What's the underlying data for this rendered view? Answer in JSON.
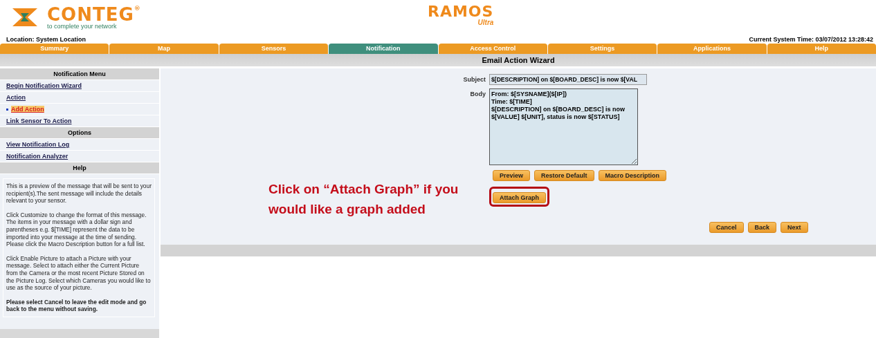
{
  "header": {
    "brand": "CONTEG",
    "brand_mark": "®",
    "tagline": "to complete your network",
    "product": "RAMOS",
    "product_sub": "Ultra"
  },
  "location": "Location: System Location",
  "system_time": "Current System Time: 03/07/2012 13:28:42",
  "tabs": [
    {
      "label": "Summary",
      "selected": false
    },
    {
      "label": "Map",
      "selected": false
    },
    {
      "label": "Sensors",
      "selected": false
    },
    {
      "label": "Notification",
      "selected": true
    },
    {
      "label": "Access Control",
      "selected": false
    },
    {
      "label": "Settings",
      "selected": false
    },
    {
      "label": "Applications",
      "selected": false
    },
    {
      "label": "Help",
      "selected": false
    }
  ],
  "page_title": "Email Action Wizard",
  "sidebar": {
    "sections": [
      {
        "title": "Notification Menu",
        "items": [
          {
            "label": "Begin Notification Wizard",
            "kind": "link",
            "selected": false
          },
          {
            "label": "Action",
            "kind": "link",
            "selected": false
          },
          {
            "label": "Add Action",
            "kind": "sub",
            "selected": true
          },
          {
            "label": "Link Sensor To Action",
            "kind": "link",
            "selected": false
          }
        ]
      },
      {
        "title": "Options",
        "items": [
          {
            "label": "View Notification Log",
            "kind": "link",
            "selected": false
          },
          {
            "label": "Notification Analyzer",
            "kind": "link",
            "selected": false
          }
        ]
      },
      {
        "title": "Help"
      }
    ],
    "help_paragraphs": [
      "This is a preview of the message that will be sent to your recipient(s).The sent message will include the details relevant to your sensor.",
      "Click Customize to change the format of this message. The items in your message with a dollar sign and parentheses e.g. $[TIME] represent the data to be imported into your message at the time of sending. Please click the Macro Description button for a full list.",
      "Click Enable Picture to attach a Picture with your message. Select to attach either the Current Picture from the Camera or the most recent Picture Stored on the Picture Log. Select which Cameras you would like to use as the source of your picture.",
      "**Please select Cancel to leave the edit mode and go back to the menu without saving.**"
    ]
  },
  "form": {
    "subject_label": "Subject",
    "subject": "$[DESCRIPTION] on $[BOARD_DESC] is now $[VAL",
    "body_label": "Body",
    "body": "From: $[SYSNAME]($[IP])\nTime: $[TIME]\n$[DESCRIPTION] on $[BOARD_DESC] is now\n$[VALUE] $[UNIT], status is now $[STATUS]",
    "buttons": [
      "Preview",
      "Restore Default",
      "Macro Description"
    ],
    "attach_button": "Attach Graph",
    "nav_buttons": [
      "Cancel",
      "Back",
      "Next"
    ]
  },
  "annotation": "Click on “Attach Graph” if you would like a graph added"
}
